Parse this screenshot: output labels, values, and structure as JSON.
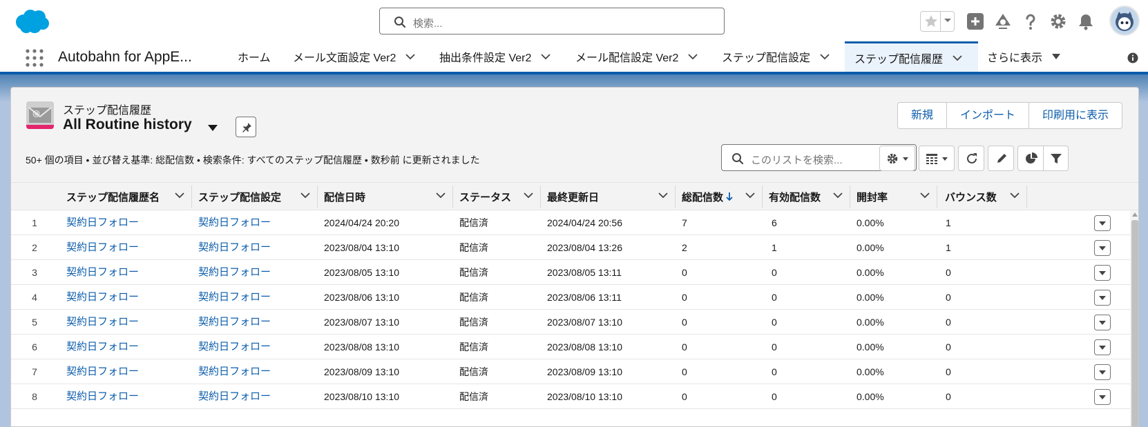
{
  "header": {
    "search_placeholder": "検索...",
    "brand_color": "#00a1e0"
  },
  "app_nav": {
    "app_name": "Autobahn for AppE...",
    "tabs": [
      {
        "label": "ホーム",
        "has_menu": false,
        "active": false
      },
      {
        "label": "メール文面設定 Ver2",
        "has_menu": true,
        "active": false
      },
      {
        "label": "抽出条件設定 Ver2",
        "has_menu": true,
        "active": false
      },
      {
        "label": "メール配信設定 Ver2",
        "has_menu": true,
        "active": false
      },
      {
        "label": "ステップ配信設定",
        "has_menu": true,
        "active": false
      },
      {
        "label": "ステップ配信履歴",
        "has_menu": true,
        "active": true
      },
      {
        "label": "さらに表示",
        "has_menu": true,
        "active": false
      }
    ]
  },
  "list": {
    "object_label": "ステップ配信履歴",
    "view_title": "All Routine history",
    "buttons": {
      "new": "新規",
      "import": "インポート",
      "print": "印刷用に表示"
    },
    "summary": "50+ 個の項目 • 並び替え基準: 総配信数 • 検索条件: すべてのステップ配信履歴 • 数秒前 に更新されました",
    "search_placeholder": "このリストを検索...",
    "columns": [
      "ステップ配信履歴名",
      "ステップ配信設定",
      "配信日時",
      "ステータス",
      "最終更新日",
      "総配信数",
      "有効配信数",
      "開封率",
      "バウンス数"
    ],
    "sorted_column": "総配信数",
    "rows": [
      {
        "num": "1",
        "name": "契約日フォロー",
        "setting": "契約日フォロー",
        "sent_at": "2024/04/24 20:20",
        "status": "配信済",
        "modified": "2024/04/24 20:56",
        "total": "7",
        "valid": "6",
        "open_rate": "0.00%",
        "bounce": "1"
      },
      {
        "num": "2",
        "name": "契約日フォロー",
        "setting": "契約日フォロー",
        "sent_at": "2023/08/04 13:10",
        "status": "配信済",
        "modified": "2023/08/04 13:26",
        "total": "2",
        "valid": "1",
        "open_rate": "0.00%",
        "bounce": "1"
      },
      {
        "num": "3",
        "name": "契約日フォロー",
        "setting": "契約日フォロー",
        "sent_at": "2023/08/05 13:10",
        "status": "配信済",
        "modified": "2023/08/05 13:11",
        "total": "0",
        "valid": "0",
        "open_rate": "0.00%",
        "bounce": "0"
      },
      {
        "num": "4",
        "name": "契約日フォロー",
        "setting": "契約日フォロー",
        "sent_at": "2023/08/06 13:10",
        "status": "配信済",
        "modified": "2023/08/06 13:11",
        "total": "0",
        "valid": "0",
        "open_rate": "0.00%",
        "bounce": "0"
      },
      {
        "num": "5",
        "name": "契約日フォロー",
        "setting": "契約日フォロー",
        "sent_at": "2023/08/07 13:10",
        "status": "配信済",
        "modified": "2023/08/07 13:10",
        "total": "0",
        "valid": "0",
        "open_rate": "0.00%",
        "bounce": "0"
      },
      {
        "num": "6",
        "name": "契約日フォロー",
        "setting": "契約日フォロー",
        "sent_at": "2023/08/08 13:10",
        "status": "配信済",
        "modified": "2023/08/08 13:10",
        "total": "0",
        "valid": "0",
        "open_rate": "0.00%",
        "bounce": "0"
      },
      {
        "num": "7",
        "name": "契約日フォロー",
        "setting": "契約日フォロー",
        "sent_at": "2023/08/09 13:10",
        "status": "配信済",
        "modified": "2023/08/09 13:10",
        "total": "0",
        "valid": "0",
        "open_rate": "0.00%",
        "bounce": "0"
      },
      {
        "num": "8",
        "name": "契約日フォロー",
        "setting": "契約日フォロー",
        "sent_at": "2023/08/10 13:10",
        "status": "配信済",
        "modified": "2023/08/10 13:10",
        "total": "0",
        "valid": "0",
        "open_rate": "0.00%",
        "bounce": "0"
      }
    ]
  },
  "icons": {
    "logo": "salesforce-cloud-logo",
    "favorites": "star-icon",
    "add": "plus-icon",
    "trailhead": "trailhead-icon",
    "help": "question-icon",
    "settings": "gear-icon",
    "notifications": "bell-icon",
    "app_launcher": "waffle-icon"
  }
}
